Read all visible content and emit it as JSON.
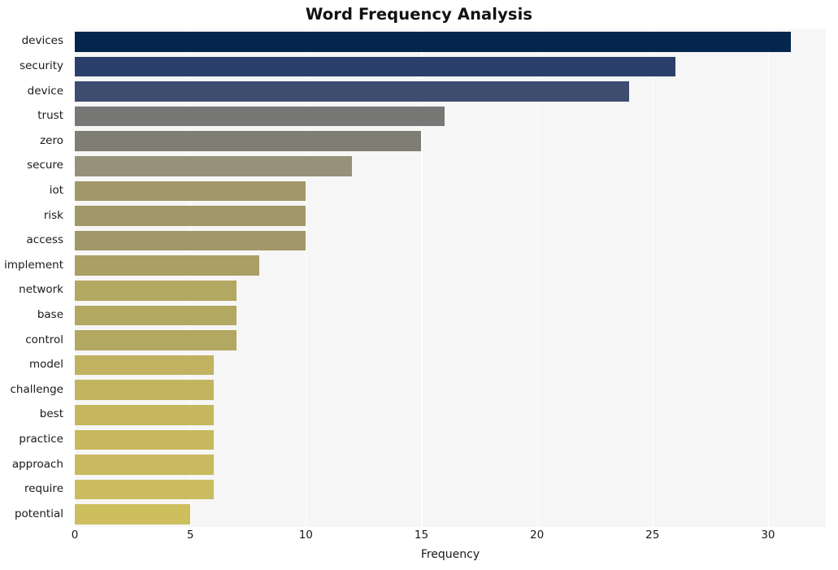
{
  "chart_data": {
    "type": "bar",
    "orientation": "horizontal",
    "title": "Word Frequency Analysis",
    "xlabel": "Frequency",
    "ylabel": "",
    "categories": [
      "devices",
      "security",
      "device",
      "trust",
      "zero",
      "secure",
      "iot",
      "risk",
      "access",
      "implement",
      "network",
      "base",
      "control",
      "model",
      "challenge",
      "best",
      "practice",
      "approach",
      "require",
      "potential"
    ],
    "values": [
      31,
      26,
      24,
      16,
      15,
      12,
      10,
      10,
      10,
      8,
      7,
      7,
      7,
      6,
      6,
      6,
      6,
      6,
      6,
      5
    ],
    "xlim": [
      0,
      32.5
    ],
    "xticks": [
      0,
      5,
      10,
      15,
      20,
      25,
      30
    ],
    "xticklabels": [
      "0",
      "5",
      "10",
      "15",
      "20",
      "25",
      "30"
    ],
    "grid": true,
    "grid_axis": "x",
    "legend": null,
    "colormap": "cividis",
    "bar_colors": [
      "#04254e",
      "#2a3f6b",
      "#3e4c70",
      "#777776",
      "#7f7e74",
      "#98917a",
      "#a09868",
      "#a09868",
      "#a09868",
      "#aaa066",
      "#b3a862",
      "#b3a862",
      "#b3a862",
      "#c0b260",
      "#c3b55f",
      "#c6b75f",
      "#c8b95f",
      "#c9ba5f",
      "#cbbc5f",
      "#cdbe5e"
    ],
    "plot_background": "#f6f6f6",
    "grid_color": "#ffffff",
    "figure_background": "#ffffff"
  },
  "axis_geometry": {
    "x_min_value": 0,
    "x_max_value": 32.5,
    "row_count": 20
  }
}
